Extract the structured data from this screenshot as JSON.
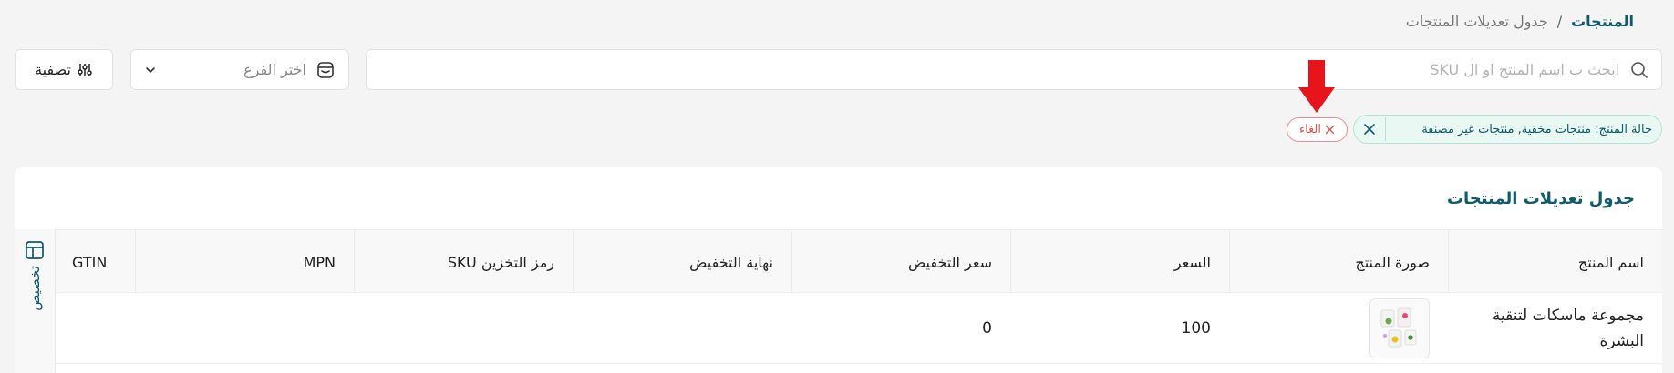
{
  "breadcrumb": {
    "root": "المنتجات",
    "separator": "/",
    "current": "جدول تعديلات المنتجات"
  },
  "search": {
    "placeholder": "ابحث ب اسم المنتج او ال SKU",
    "value": ""
  },
  "branch_select": {
    "placeholder": "اختر الفرع"
  },
  "filter_button": {
    "label": "تصفية"
  },
  "active_filter": {
    "text": "حالة المنتج: منتجات مخفية, منتجات غير مصنفة"
  },
  "cancel_button": {
    "label": "الغاء"
  },
  "card": {
    "title": "جدول تعديلات المنتجات"
  },
  "table": {
    "columns": [
      "اسم المنتج",
      "صورة المنتج",
      "السعر",
      "سعر التخفيض",
      "نهاية التخفيض",
      "رمز التخزين SKU",
      "MPN",
      "GTIN"
    ],
    "rows": [
      {
        "name": "مجموعة ماسكات لتنقية البشرة",
        "price": "100",
        "sale_price": "0",
        "sale_end": "",
        "sku": "",
        "mpn": "",
        "gtin": ""
      }
    ]
  },
  "customize": {
    "label": "تخصيص"
  },
  "colors": {
    "brand": "#0d5b6b",
    "chip_bg": "#e9f8f3",
    "danger": "#e05252",
    "arrow": "#e8141b"
  }
}
